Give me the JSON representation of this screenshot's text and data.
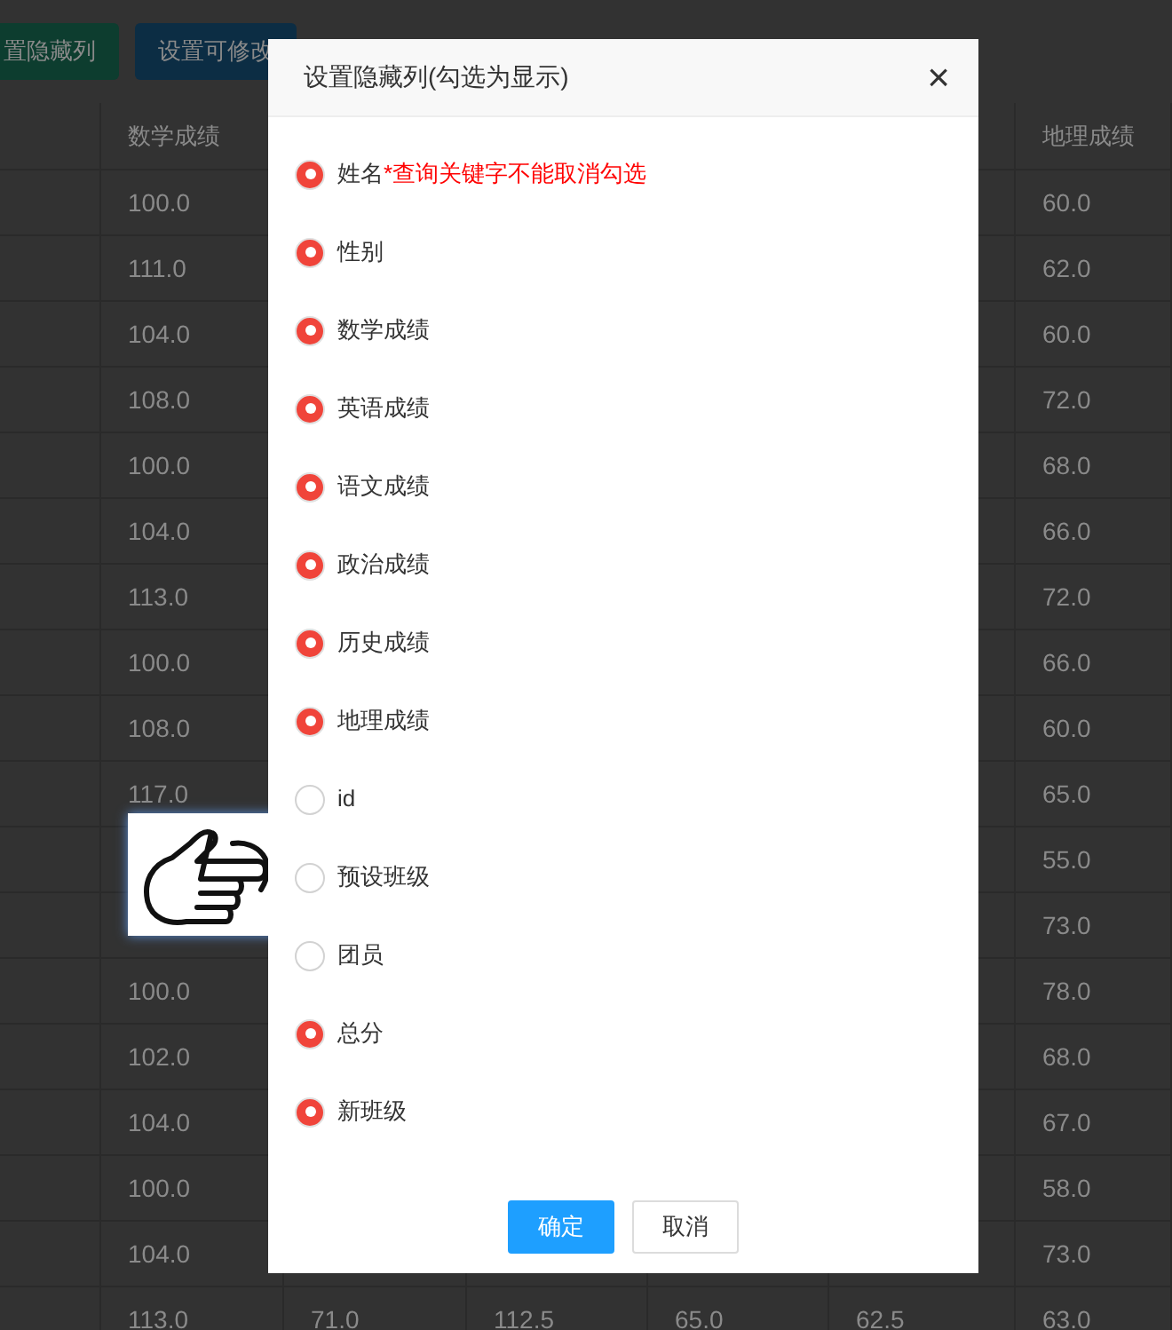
{
  "toolbar": {
    "buttons": [
      {
        "label": "置隐藏列",
        "kind": "green"
      },
      {
        "label": "设置可修改",
        "kind": "blue"
      }
    ]
  },
  "table": {
    "columns": [
      {},
      {
        "label": "数学成绩"
      },
      {},
      {},
      {},
      {},
      {
        "label": "地理成绩"
      }
    ],
    "rows": [
      [
        "",
        "100.0",
        "",
        "",
        "",
        "",
        "60.0"
      ],
      [
        "",
        "111.0",
        "",
        "",
        "",
        "",
        "62.0"
      ],
      [
        "",
        "104.0",
        "",
        "",
        "",
        "",
        "60.0"
      ],
      [
        "",
        "108.0",
        "",
        "",
        "",
        "",
        "72.0"
      ],
      [
        "",
        "100.0",
        "",
        "",
        "",
        "",
        "68.0"
      ],
      [
        "",
        "104.0",
        "",
        "",
        "",
        "",
        "66.0"
      ],
      [
        "",
        "113.0",
        "",
        "",
        "",
        "",
        "72.0"
      ],
      [
        "",
        "100.0",
        "",
        "",
        "",
        "",
        "66.0"
      ],
      [
        "",
        "108.0",
        "",
        "",
        "",
        "",
        "60.0"
      ],
      [
        "",
        "117.0",
        "",
        "",
        "",
        "",
        "65.0"
      ],
      [
        "",
        "",
        "",
        "",
        "",
        "",
        "55.0"
      ],
      [
        "",
        "",
        "",
        "",
        "",
        "",
        "73.0"
      ],
      [
        "",
        "100.0",
        "",
        "",
        "",
        "",
        "78.0"
      ],
      [
        "",
        "102.0",
        "",
        "",
        "",
        "",
        "68.0"
      ],
      [
        "",
        "104.0",
        "",
        "",
        "",
        "",
        "67.0"
      ],
      [
        "",
        "100.0",
        "",
        "",
        "",
        "",
        "58.0"
      ],
      [
        "",
        "104.0",
        "",
        "",
        "",
        "",
        "73.0"
      ],
      [
        "",
        "113.0",
        "71.0",
        "112.5",
        "65.0",
        "62.5",
        "63.0"
      ]
    ]
  },
  "dialog": {
    "title": "设置隐藏列(勾选为显示)",
    "close": "×",
    "options": [
      {
        "label": "姓名",
        "note": "*查询关键字不能取消勾选",
        "checked": true
      },
      {
        "label": "性别",
        "checked": true
      },
      {
        "label": "数学成绩",
        "checked": true
      },
      {
        "label": "英语成绩",
        "checked": true
      },
      {
        "label": "语文成绩",
        "checked": true
      },
      {
        "label": "政治成绩",
        "checked": true
      },
      {
        "label": "历史成绩",
        "checked": true
      },
      {
        "label": "地理成绩",
        "checked": true
      },
      {
        "label": "id",
        "checked": false
      },
      {
        "label": "预设班级",
        "checked": false
      },
      {
        "label": "团员",
        "checked": false
      },
      {
        "label": "总分",
        "checked": true
      },
      {
        "label": "新班级",
        "checked": true
      }
    ],
    "buttons": [
      {
        "label": "确定",
        "kind": "primary"
      },
      {
        "label": "取消",
        "kind": "default"
      }
    ]
  }
}
